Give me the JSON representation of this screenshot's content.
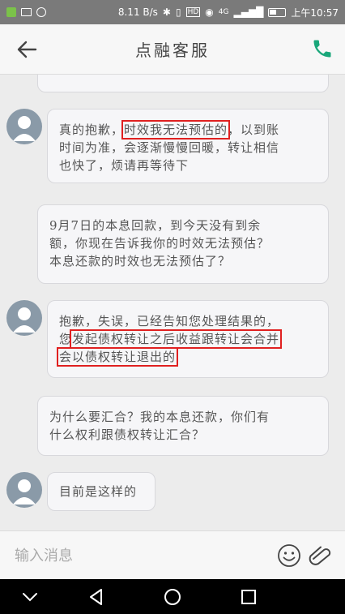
{
  "status_bar": {
    "speed": "8.11 B/s",
    "network": "4G",
    "time": "上午10:57",
    "icons": [
      "app-icon",
      "mail-icon",
      "sync-icon",
      "bluetooth-icon",
      "vibrate-icon",
      "hd-icon",
      "eye-icon",
      "signal-icon",
      "battery-icon"
    ]
  },
  "header": {
    "title": "点融客服",
    "back_icon": "arrow-left-icon",
    "call_icon": "phone-icon",
    "accent": "#1aa77a"
  },
  "messages": [
    {
      "from": "agent",
      "lines": [
        "真的抱歉，",
        "时效我无法预估的",
        "，以到账",
        "时间为准，会逐渐慢慢回暖，转让相信",
        "也快了，烦请再等待下"
      ],
      "highlight": "时效我无法预估的"
    },
    {
      "from": "user",
      "lines": [
        "9月7日的本息回款，到今天没有到余",
        "额，你现在告诉我你的时效无法预估？",
        "本息还款的时效也无法预估了？"
      ]
    },
    {
      "from": "agent",
      "lines": [
        "抱歉，失误，已经告知您处理结果的，",
        "您",
        "发起债权转让之后收益跟转让会合并",
        "会以债权转让退出的"
      ],
      "highlight": "发起债权转让之后收益跟转让会合并 会以债权转让退出的"
    },
    {
      "from": "user",
      "lines": [
        "为什么要汇合？我的本息还款，你们有",
        "什么权利跟债权转让汇合？"
      ]
    },
    {
      "from": "agent",
      "lines": [
        "目前是这样的"
      ]
    }
  ],
  "input": {
    "placeholder": "输入消息"
  },
  "colors": {
    "highlight": "#e02020",
    "bubble_bg": "#f6f6f8",
    "avatar": "#8a9aa8"
  }
}
